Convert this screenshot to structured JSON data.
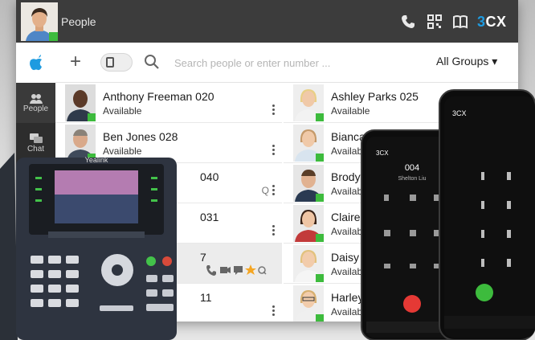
{
  "titlebar": {
    "title": "People",
    "brand_3": "3",
    "brand_cx": "CX"
  },
  "sidebar": {
    "items": [
      {
        "label": "People"
      },
      {
        "label": "Chat"
      }
    ]
  },
  "toolbar": {
    "search_placeholder": "Search people or enter number ...",
    "group_label": "All Groups ▾"
  },
  "contacts": {
    "left": [
      {
        "name": "Anthony Freeman 020",
        "presence": "Available"
      },
      {
        "name": "Ben Jones 028",
        "presence": "Available"
      },
      {
        "name": "040"
      },
      {
        "name": "031"
      },
      {
        "name": "7"
      },
      {
        "name": "11"
      }
    ],
    "right": [
      {
        "name": "Ashley Parks 025",
        "presence": "Available"
      },
      {
        "name": "Bianca M",
        "presence": "Availab"
      },
      {
        "name": "Brody",
        "presence": "Availab"
      },
      {
        "name": "Claire",
        "presence": "Availab"
      },
      {
        "name": "Daisy",
        "presence": "Availab"
      },
      {
        "name": "Harley",
        "presence": "Availab"
      }
    ]
  },
  "deskphone": {
    "brand": "Yealink"
  },
  "mobile_mid": {
    "header": "3CX",
    "number": "004",
    "caller": "Shelton Liu"
  },
  "mobile_right": {
    "header": "3CX"
  },
  "colors": {
    "accent": "#1e9be0",
    "presence_green": "#3dbb3d",
    "titlebar": "#3c3c3c",
    "star": "#f5a623"
  }
}
